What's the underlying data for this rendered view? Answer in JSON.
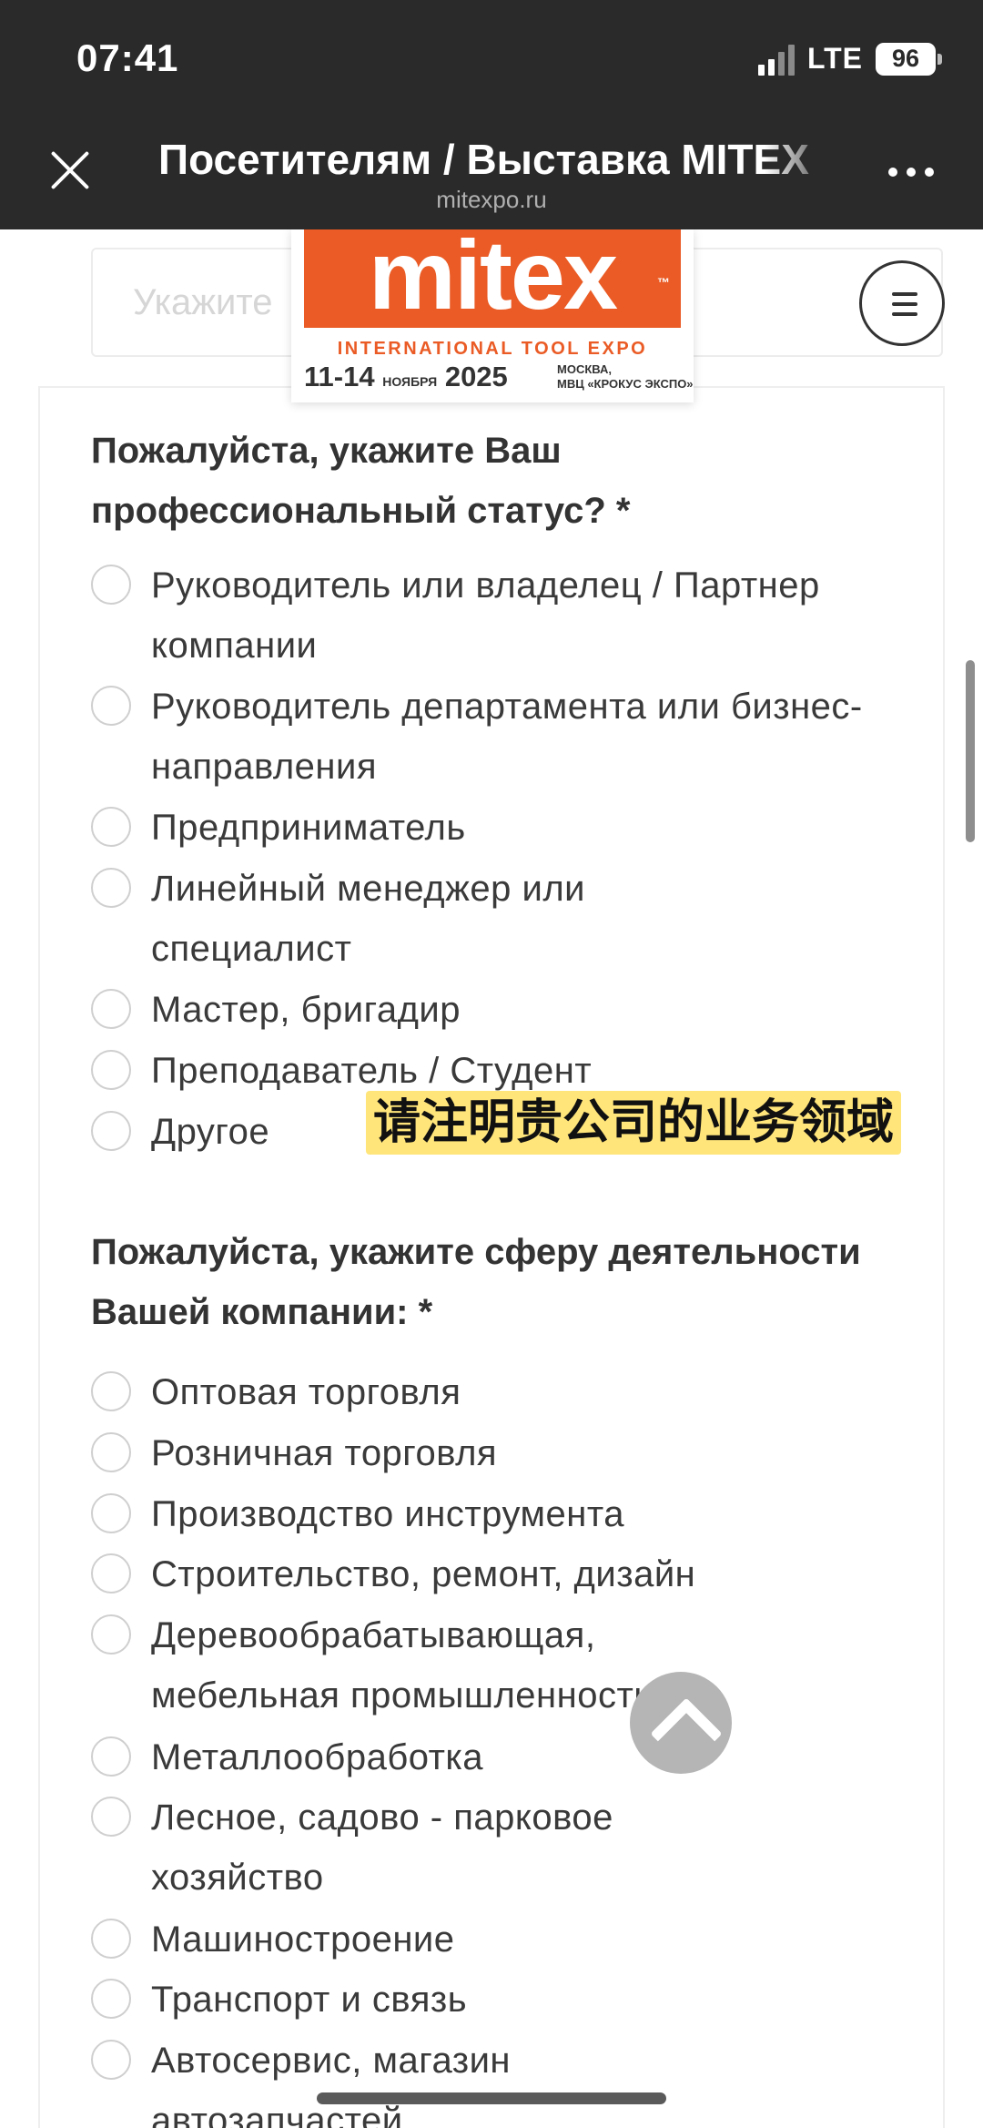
{
  "status_bar": {
    "time": "07:41",
    "network": "LTE",
    "battery": "96",
    "icons": [
      "signal-icon",
      "battery-icon"
    ]
  },
  "browser": {
    "title": "Посетителям / Выставка MITEX",
    "url": "mitexpo.ru",
    "icons": [
      "close-icon",
      "more-icon"
    ]
  },
  "site": {
    "prev_field_placeholder": "Укажите",
    "logo": {
      "brand": "mitex",
      "tm": "™",
      "subtitle": "INTERNATIONAL TOOL EXPO",
      "dates": "11-14",
      "month": "НОЯБРЯ",
      "year": "2025",
      "place_line1": "МОСКВА,",
      "place_line2": "МВЦ «КРОКУС ЭКСПО»"
    },
    "menu_icon": "hamburger-icon"
  },
  "form": {
    "status_question": "Пожалуйста, укажите Ваш профессиональный статус? *",
    "status_options": [
      "Руководитель или владелец / Партнер компании",
      "Руководитель департамента или бизнес-направления",
      "Предприниматель",
      "Линейный менеджер или специалист",
      "Мастер, бригадир",
      "Преподаватель / Студент",
      "Другое"
    ],
    "sphere_question": "Пожалуйста, укажите сферу деятельности Вашей компании: *",
    "sphere_options": [
      "Оптовая торговля",
      "Розничная торговля",
      "Производство инструмента",
      "Строительство, ремонт, дизайн",
      "Деревообрабатывающая, мебельная промышленность",
      "Металлообработка",
      "Лесное, садово - парковое хозяйство",
      "Машиностроение",
      "Транспорт и связь",
      "Автосервис, магазин автозапчастей"
    ]
  },
  "overlay": {
    "caption": "请注明贵公司的业务领域",
    "scroll_top_icon": "chevron-up-icon"
  },
  "colors": {
    "brand_orange": "#ea5b25",
    "header_bg": "#2a2a2a",
    "caption_bg": "#ffe57a"
  }
}
